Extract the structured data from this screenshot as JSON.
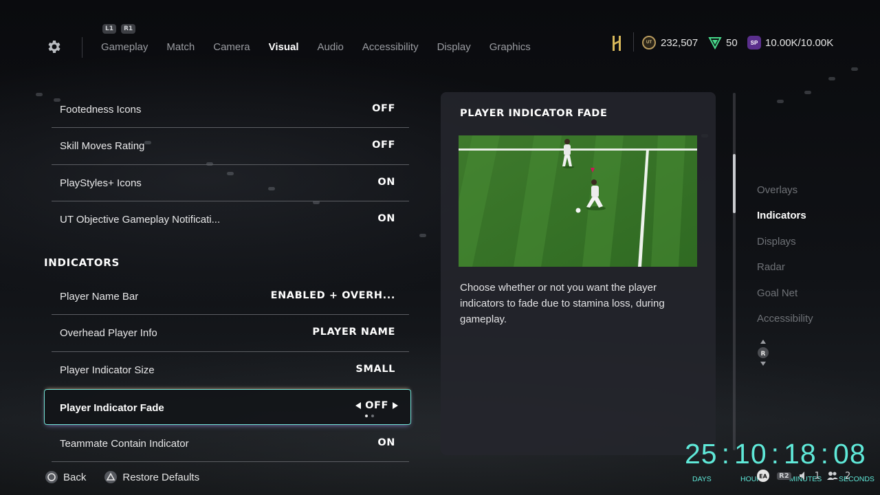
{
  "nav": {
    "bumpers": [
      "L1",
      "R1"
    ],
    "tabs": [
      "Gameplay",
      "Match",
      "Camera",
      "Visual",
      "Audio",
      "Accessibility",
      "Display",
      "Graphics"
    ],
    "active_tab": "Visual"
  },
  "currency": {
    "coins": "232,507",
    "coins_icon_text": "UT",
    "points": "50",
    "season_points": "10.00K/10.00K",
    "season_icon_text": "SP"
  },
  "settings": {
    "rows_top": [
      {
        "label": "Footedness Icons",
        "value": "OFF"
      },
      {
        "label": "Skill Moves Rating",
        "value": "OFF"
      },
      {
        "label": "PlayStyles+ Icons",
        "value": "ON"
      },
      {
        "label": "UT Objective Gameplay Notificati...",
        "value": "ON"
      }
    ],
    "section_title": "INDICATORS",
    "rows_indicators": [
      {
        "label": "Player Name Bar",
        "value": "ENABLED + OVERH..."
      },
      {
        "label": "Overhead Player Info",
        "value": "PLAYER NAME"
      },
      {
        "label": "Player Indicator Size",
        "value": "SMALL"
      }
    ],
    "selected": {
      "label": "Player Indicator Fade",
      "value": "OFF"
    },
    "rows_bottom": [
      {
        "label": "Teammate Contain Indicator",
        "value": "ON"
      }
    ]
  },
  "panel": {
    "title": "PLAYER INDICATOR FADE",
    "description": "Choose whether or not you want the player indicators to fade due to stamina loss, during gameplay."
  },
  "subnav": {
    "items": [
      "Overlays",
      "Indicators",
      "Displays",
      "Radar",
      "Goal Net",
      "Accessibility"
    ],
    "active": "Indicators",
    "stick_label": "R"
  },
  "footer": {
    "back": "Back",
    "restore": "Restore Defaults"
  },
  "countdown": {
    "days": "25",
    "hours": "10",
    "minutes": "18",
    "seconds": "08",
    "labels": {
      "days": "DAYS",
      "hours": "HOURS",
      "minutes": "MINUTES",
      "seconds": "SECONDS"
    }
  },
  "overlay": {
    "ea": "EA",
    "r2": "R2",
    "count_a": "1",
    "count_b": "2"
  },
  "colors": {
    "accent_teal": "#5fe8d8",
    "selected_border": "#6fe0d3",
    "panel_bg": "#24262c",
    "season_purple": "#5a2f8c",
    "coin_gold": "#b89b5e",
    "points_green": "#47d98a"
  },
  "icons": {
    "settings": "gear-icon",
    "club": "club-crest-icon",
    "coins": "ut-coin-icon",
    "points": "fc-points-icon",
    "season": "sp-icon",
    "back": "circle-button-icon",
    "restore": "triangle-button-icon",
    "stick": "right-stick-icon"
  }
}
